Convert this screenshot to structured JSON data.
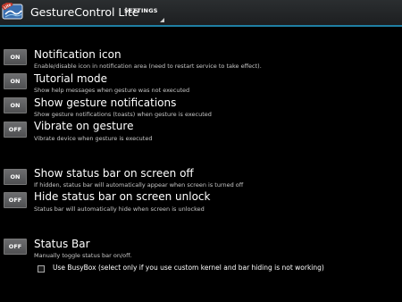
{
  "app": {
    "title": "GestureControl Lite",
    "logo_badge": "Lite",
    "tab": "SETTINGS"
  },
  "settings": [
    {
      "button": "ON",
      "title": "Notification icon",
      "description": "Enable/disable icon in notification area (need to restart service to take effect)."
    },
    {
      "button": "ON",
      "title": "Tutorial mode",
      "description": "Show help messages when gesture was not executed"
    },
    {
      "button": "ON",
      "title": "Show gesture notifications",
      "description": "Show gesture notifications (toasts) when gesture is executed"
    },
    {
      "button": "OFF",
      "title": "Vibrate on gesture",
      "description": "Vibrate device when gesture is executed"
    },
    {
      "button": "ON",
      "title": "Show status bar on screen off",
      "description": "If hidden, status bar will automatically appear when screen is turned off"
    },
    {
      "button": "OFF",
      "title": "Hide status bar on screen unlock",
      "description": "Status bar will automatically hide when screen is unlocked"
    },
    {
      "button": "OFF",
      "title": "Status Bar",
      "description": "Manually toggle status bar on/off."
    }
  ],
  "busybox": {
    "label": "Use BusyBox (select only if you use custom kernel and bar hiding is not working)",
    "checked": false
  },
  "colors": {
    "accent": "#1f7fa3",
    "background": "#000000",
    "button": "#5e5f61"
  }
}
